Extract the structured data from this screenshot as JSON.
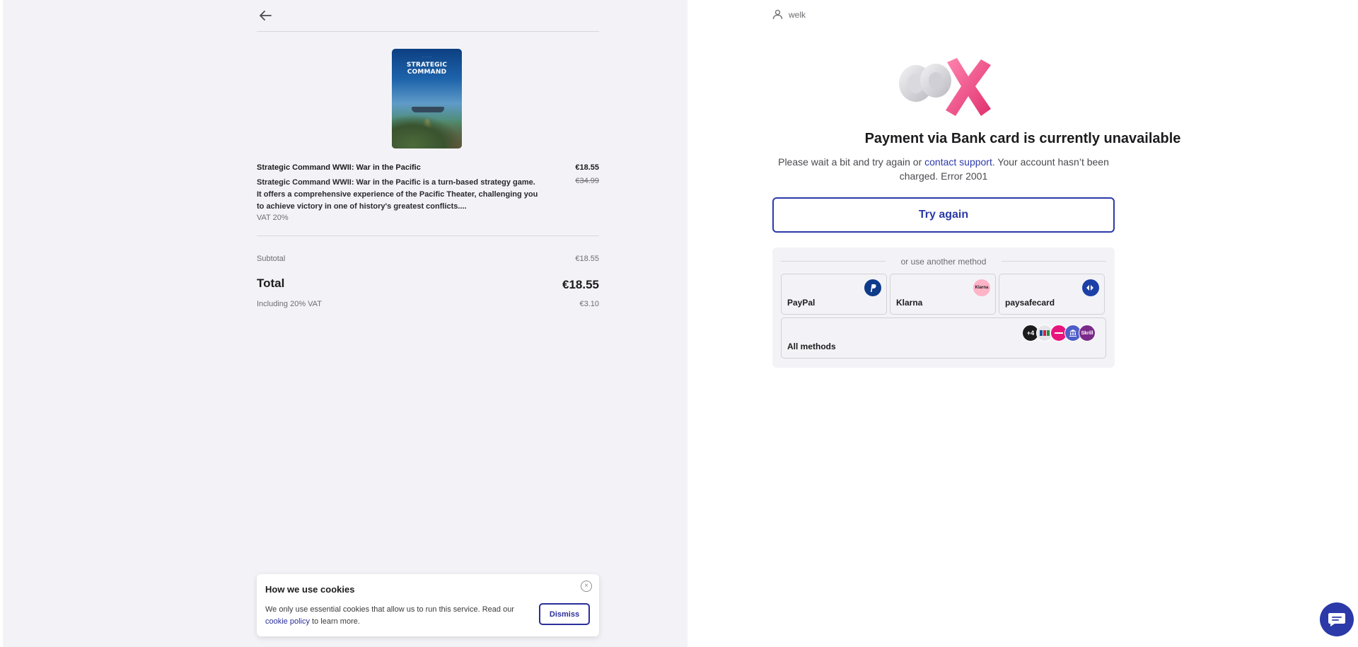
{
  "order": {
    "product_title": "Strategic Command WWII: War in the Pacific",
    "product_price": "€18.55",
    "product_description": "Strategic Command WWII: War in the Pacific is a turn-based strategy game. It offers a comprehensive experience of the Pacific Theater, challenging you to achieve victory in one of history's greatest conflicts....",
    "product_old_price": "€34.99",
    "product_vat": "VAT 20%",
    "cover_title": "STRATEGIC COMMAND",
    "subtotal_label": "Subtotal",
    "subtotal_value": "€18.55",
    "total_label": "Total",
    "total_value": "€18.55",
    "vat_label": "Including 20% VAT",
    "vat_value": "€3.10"
  },
  "cookie_banner": {
    "title": "How we use cookies",
    "text_before": "We only use essential cookies that allow us to run this service. Read our ",
    "link": "cookie policy",
    "text_after": " to learn more.",
    "dismiss_label": "Dismiss",
    "close_symbol": "×"
  },
  "user": {
    "name": "welk"
  },
  "error": {
    "title": "Payment via Bank card is currently unavailable",
    "msg_before": "Please wait a bit and try again or ",
    "msg_link": "contact support",
    "msg_after": ". Your account hasn’t been charged. Error 2001",
    "try_again_label": "Try again"
  },
  "other_methods": {
    "label": "or use another method",
    "methods": [
      {
        "name": "PayPal",
        "logo": "paypal-logo",
        "logo_color": "#0f3b8a"
      },
      {
        "name": "Klarna",
        "logo": "klarna-logo",
        "logo_color": "#ffb3c7",
        "logo_text": "Klarna"
      },
      {
        "name": "paysafecard",
        "logo": "paysafecard-logo",
        "logo_color": "#1c3fa8"
      }
    ],
    "all_methods_label": "All methods",
    "more_count": "+4",
    "stack_icons": [
      {
        "name": "more-count-icon",
        "color": "#1c1c1e"
      },
      {
        "name": "card-brands-icon",
        "color": "#e6e6ea"
      },
      {
        "name": "bancontact-icon",
        "color": "#e8157d"
      },
      {
        "name": "bank-icon",
        "color": "#4f5ec8"
      },
      {
        "name": "skrill-icon",
        "color": "#7b2a8a",
        "text": "Skrill"
      }
    ]
  },
  "colors": {
    "accent": "#2b3aa8",
    "left_bg": "#f3f3f7",
    "illus_pink": "#f2528f"
  }
}
